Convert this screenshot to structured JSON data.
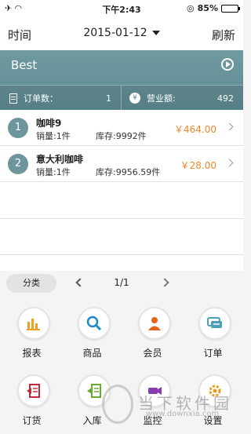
{
  "status_bar": {
    "time": "下午2:43",
    "battery": "85%",
    "battery_level": 0.85
  },
  "nav": {
    "left": "时间",
    "date": "2015-01-12",
    "right": "刷新"
  },
  "banner": {
    "title": "Best",
    "orders_label": "订单数：",
    "orders_value": "1",
    "revenue_label": "营业额:",
    "revenue_value": "492"
  },
  "orders": [
    {
      "index": "1",
      "name": "咖啡9",
      "sales": "销量:1件",
      "stock": "库存:9992件",
      "price": "￥464.00"
    },
    {
      "index": "2",
      "name": "意大利咖啡",
      "sales": "销量:1件",
      "stock": "库存:9956.59件",
      "price": "￥28.00"
    }
  ],
  "pager": {
    "category": "分类",
    "page": "1/1"
  },
  "menu": [
    {
      "label": "报表",
      "icon": "bar-chart-icon"
    },
    {
      "label": "商品",
      "icon": "search-icon"
    },
    {
      "label": "会员",
      "icon": "member-icon"
    },
    {
      "label": "订单",
      "icon": "chat-icon"
    },
    {
      "label": "订货",
      "icon": "order-goods-icon"
    },
    {
      "label": "入库",
      "icon": "stock-in-icon"
    },
    {
      "label": "监控",
      "icon": "monitor-icon"
    },
    {
      "label": "设置",
      "icon": "settings-icon"
    }
  ],
  "watermark": {
    "text": "当下软件园",
    "url": "www.downxia.com"
  },
  "colors": {
    "accent": "#5e8a91",
    "price": "#e8892a"
  }
}
